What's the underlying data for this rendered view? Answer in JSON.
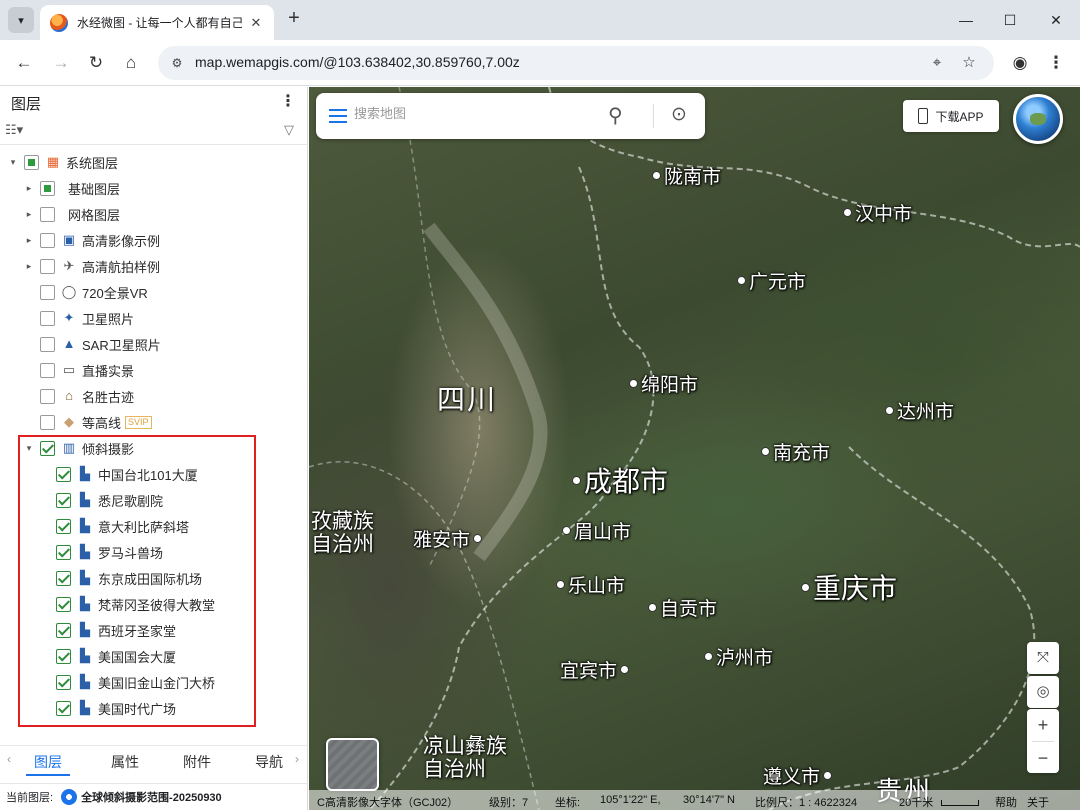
{
  "browser": {
    "tab_title": "水经微图 - 让每一个人都有自己的地图",
    "url": "map.wemapgis.com/@103.638402,30.859760,7.00z"
  },
  "panel": {
    "title": "图层",
    "tree": [
      {
        "label": "系统图层",
        "expander": "▾",
        "check": "partial",
        "icon": "grid-icon",
        "indent": 0
      },
      {
        "label": "基础图层",
        "expander": "▸",
        "check": "partial",
        "icon": "",
        "indent": 1
      },
      {
        "label": "网格图层",
        "expander": "▸",
        "check": "none",
        "icon": "",
        "indent": 1
      },
      {
        "label": "高清影像示例",
        "expander": "▸",
        "check": "none",
        "icon": "image-icon",
        "indent": 1
      },
      {
        "label": "高清航拍样例",
        "expander": "▸",
        "check": "none",
        "icon": "drone-icon",
        "indent": 1
      },
      {
        "label": "720全景VR",
        "expander": "",
        "check": "none",
        "icon": "vr-icon",
        "indent": 1
      },
      {
        "label": "卫星照片",
        "expander": "",
        "check": "none",
        "icon": "satellite-icon",
        "indent": 1
      },
      {
        "label": "SAR卫星照片",
        "expander": "",
        "check": "none",
        "icon": "sar-icon",
        "indent": 1
      },
      {
        "label": "直播实景",
        "expander": "",
        "check": "none",
        "icon": "live-icon",
        "indent": 1
      },
      {
        "label": "名胜古迹",
        "expander": "",
        "check": "none",
        "icon": "temple-icon",
        "indent": 1
      },
      {
        "label": "等高线",
        "expander": "",
        "check": "none",
        "icon": "contour-icon",
        "indent": 1,
        "badge": "SVIP"
      },
      {
        "label": "倾斜摄影",
        "expander": "▾",
        "check": "checked",
        "icon": "building-icon",
        "indent": 1
      },
      {
        "label": "中国台北101大厦",
        "expander": "",
        "check": "checked",
        "icon": "model-icon",
        "indent": 2
      },
      {
        "label": "悉尼歌剧院",
        "expander": "",
        "check": "checked",
        "icon": "model-icon",
        "indent": 2
      },
      {
        "label": "意大利比萨斜塔",
        "expander": "",
        "check": "checked",
        "icon": "model-icon",
        "indent": 2
      },
      {
        "label": "罗马斗兽场",
        "expander": "",
        "check": "checked",
        "icon": "model-icon",
        "indent": 2
      },
      {
        "label": "东京成田国际机场",
        "expander": "",
        "check": "checked",
        "icon": "model-icon",
        "indent": 2
      },
      {
        "label": "梵蒂冈圣彼得大教堂",
        "expander": "",
        "check": "checked",
        "icon": "model-icon",
        "indent": 2
      },
      {
        "label": "西班牙圣家堂",
        "expander": "",
        "check": "checked",
        "icon": "model-icon",
        "indent": 2
      },
      {
        "label": "美国国会大厦",
        "expander": "",
        "check": "checked",
        "icon": "model-icon",
        "indent": 2
      },
      {
        "label": "美国旧金山金门大桥",
        "expander": "",
        "check": "checked",
        "icon": "model-icon",
        "indent": 2
      },
      {
        "label": "美国时代广场",
        "expander": "",
        "check": "checked",
        "icon": "model-icon",
        "indent": 2
      }
    ],
    "tabs": [
      "图层",
      "属性",
      "附件",
      "导航"
    ],
    "status_label": "当前图层:",
    "status_value": "全球倾斜摄影范围-20250930"
  },
  "map": {
    "search_placeholder": "搜索地图",
    "download_app": "下载APP",
    "cities": [
      {
        "name": "陇南市",
        "size": "sm",
        "dot_side": "left"
      },
      {
        "name": "汉中市",
        "size": "sm",
        "dot_side": "left"
      },
      {
        "name": "广元市",
        "size": "sm",
        "dot_side": "left"
      },
      {
        "name": "绵阳市",
        "size": "sm",
        "dot_side": "left"
      },
      {
        "name": "达州市",
        "size": "sm",
        "dot_side": "left"
      },
      {
        "name": "南充市",
        "size": "sm",
        "dot_side": "left"
      },
      {
        "name": "成都市",
        "size": "lg",
        "dot_side": "left"
      },
      {
        "name": "雅安市",
        "size": "sm",
        "dot_side": "right"
      },
      {
        "name": "眉山市",
        "size": "sm",
        "dot_side": "left"
      },
      {
        "name": "乐山市",
        "size": "sm",
        "dot_side": "left"
      },
      {
        "name": "重庆市",
        "size": "lg",
        "dot_side": "left"
      },
      {
        "name": "自贡市",
        "size": "sm",
        "dot_side": "left"
      },
      {
        "name": "宜宾市",
        "size": "sm",
        "dot_side": "right"
      },
      {
        "name": "泸州市",
        "size": "sm",
        "dot_side": "left"
      },
      {
        "name": "遵义市",
        "size": "sm",
        "dot_side": "right"
      }
    ],
    "regions": {
      "sichuan": "四川",
      "ganzi": "孜藏族\n自治州",
      "liangshan": "凉山彝族\n自治州",
      "guizhou": "贵州"
    },
    "status": {
      "layer": "C高清影像大字体（GCJ02）",
      "level": "级别：7",
      "coord_label": "坐标:",
      "lon": "105°1'22\" E,",
      "lat": "30°14'7\" N",
      "scale": "比例尺：1 : 4622324",
      "scale_text": "20千米",
      "help": "帮助",
      "about": "关于"
    }
  }
}
